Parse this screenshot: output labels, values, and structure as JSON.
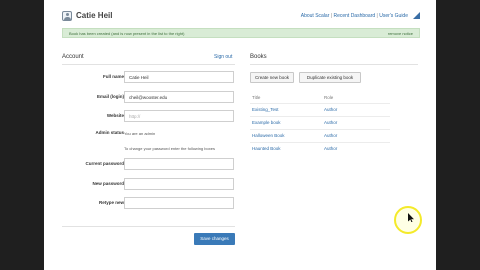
{
  "header": {
    "user_name": "Catie Heil",
    "links": [
      "About Scalar",
      "Recent Dashboard",
      "User's Guide"
    ]
  },
  "notice": {
    "text": "Book has been created (and is now present in the list to the right)",
    "dismiss": "remove notice"
  },
  "account": {
    "title": "Account",
    "signout": "Sign out",
    "fields": {
      "full_name": {
        "label": "Full name",
        "value": "Catie Heil"
      },
      "email": {
        "label": "Email (login)",
        "value": "cheil@wooster.edu"
      },
      "website": {
        "label": "Website",
        "placeholder": "http://"
      },
      "admin_status": {
        "label": "Admin status",
        "value": "You are an admin"
      },
      "password_note": "To change your password enter the following boxes",
      "current_password": {
        "label": "Current password"
      },
      "new_password": {
        "label": "New password"
      },
      "retype": {
        "label": "Retype new"
      }
    },
    "save_label": "Save changes"
  },
  "books": {
    "title": "Books",
    "create_label": "Create new book",
    "duplicate_label": "Duplicate existing book",
    "columns": [
      "Title",
      "Role"
    ],
    "rows": [
      {
        "title": "Existing_Test",
        "role": "Author"
      },
      {
        "title": "Example book",
        "role": "Author"
      },
      {
        "title": "Halloween Book",
        "role": "Author"
      },
      {
        "title": "Haunted Book",
        "role": "Author"
      }
    ]
  },
  "colors": {
    "link": "#2a6aa8",
    "notice_bg": "#d9ecd6",
    "primary_button": "#3a7ab8"
  }
}
